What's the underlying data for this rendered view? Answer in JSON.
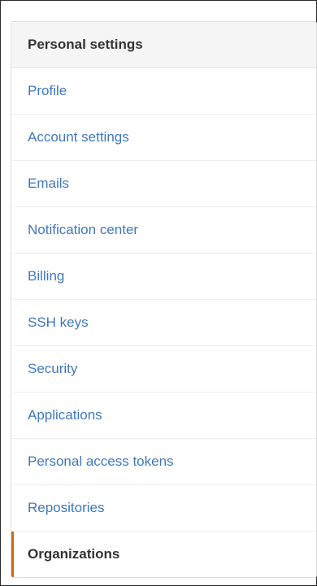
{
  "settings_menu": {
    "header": "Personal settings",
    "accent_color": "#d26911",
    "link_color": "#4078c0",
    "selected_item": "Organizations",
    "items": [
      {
        "label": "Profile"
      },
      {
        "label": "Account settings"
      },
      {
        "label": "Emails"
      },
      {
        "label": "Notification center"
      },
      {
        "label": "Billing"
      },
      {
        "label": "SSH keys"
      },
      {
        "label": "Security"
      },
      {
        "label": "Applications"
      },
      {
        "label": "Personal access tokens"
      },
      {
        "label": "Repositories"
      },
      {
        "label": "Organizations"
      }
    ]
  }
}
